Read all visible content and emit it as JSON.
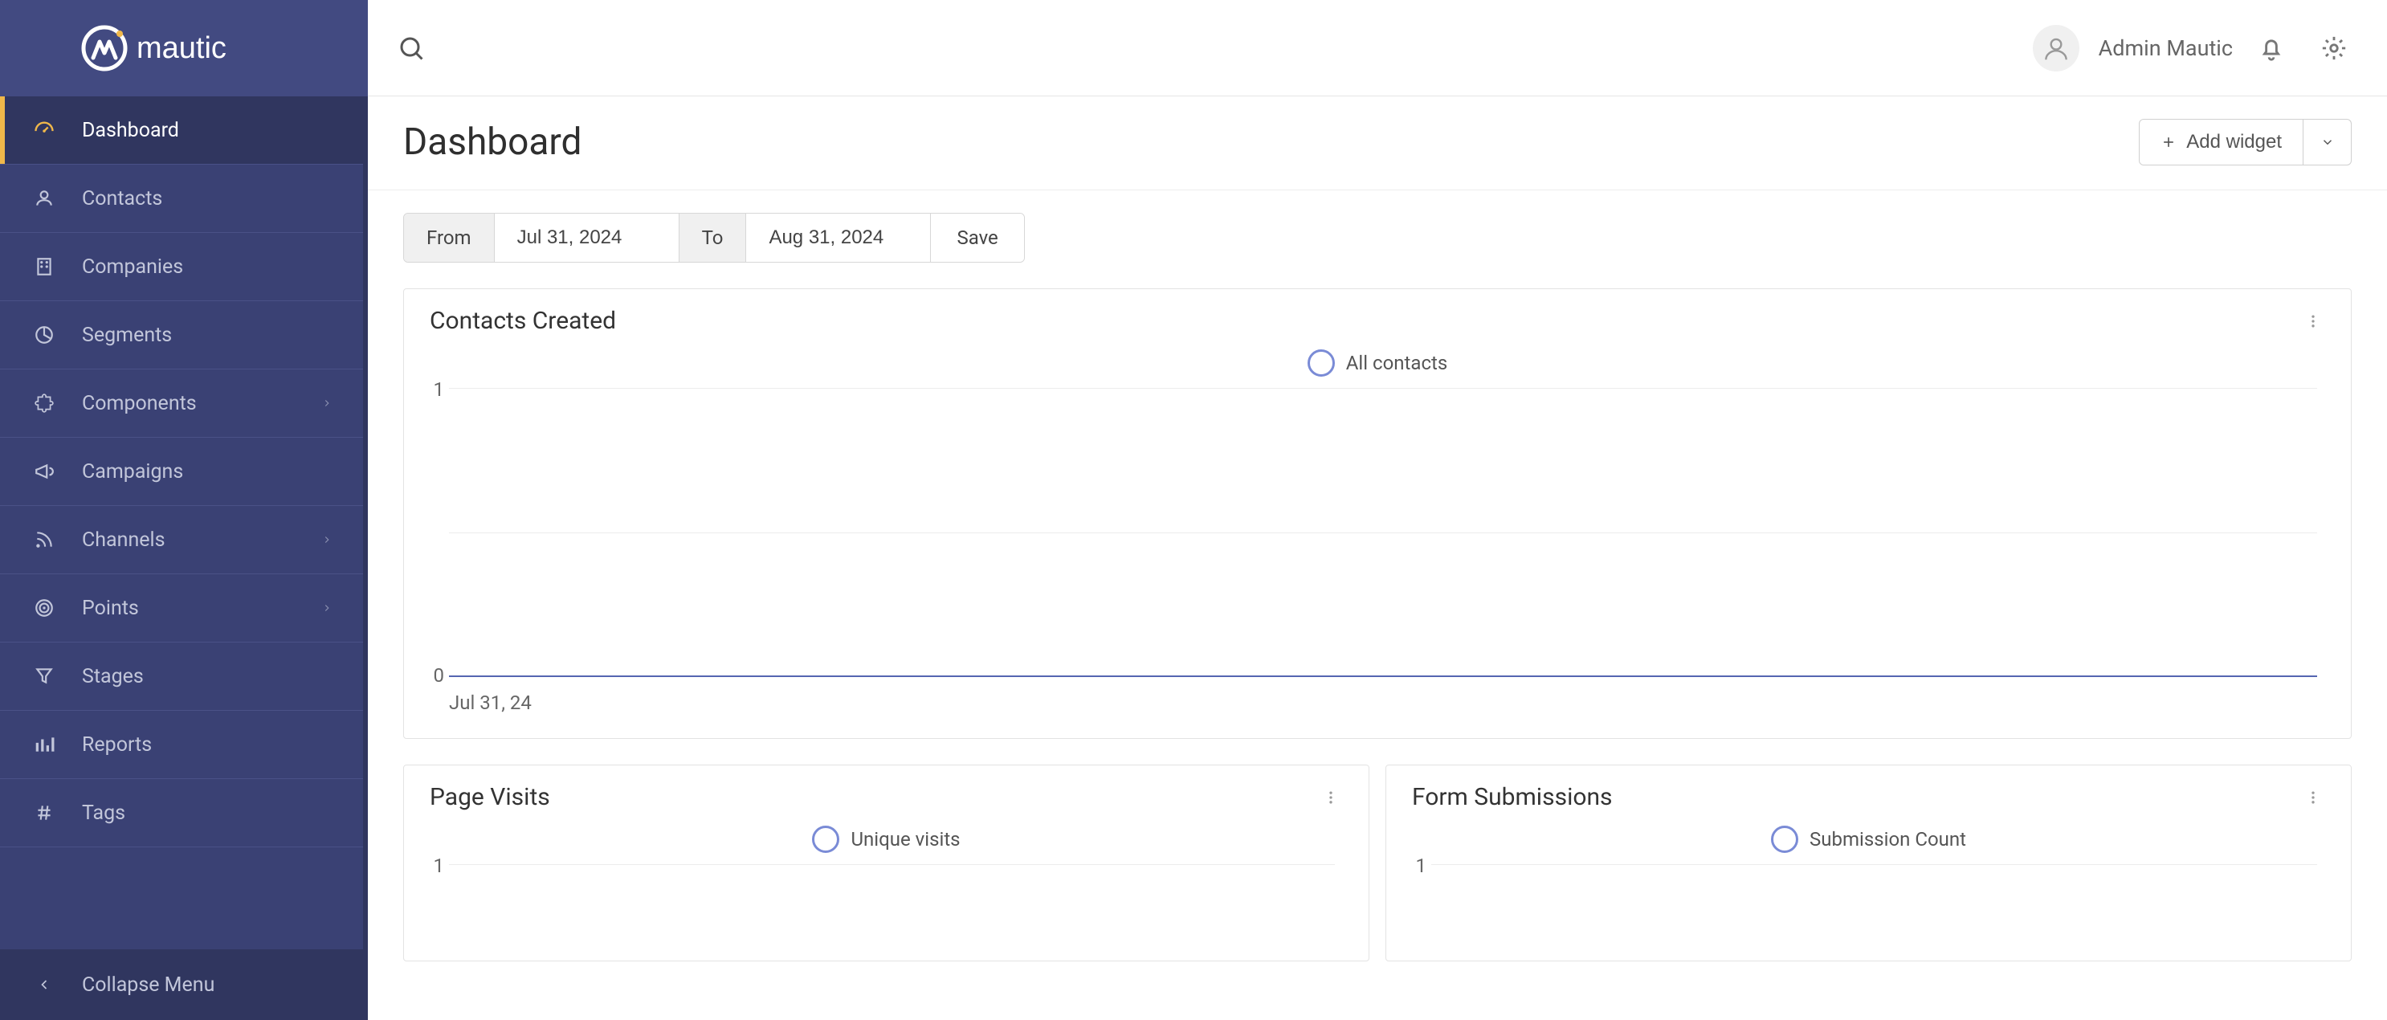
{
  "brand": {
    "name": "mautic"
  },
  "user": {
    "name": "Admin Mautic"
  },
  "page": {
    "title": "Dashboard"
  },
  "header_actions": {
    "add_widget_label": "Add widget"
  },
  "date_filter": {
    "from_label": "From",
    "to_label": "To",
    "from_value": "Jul 31, 2024",
    "to_value": "Aug 31, 2024",
    "save_label": "Save"
  },
  "sidebar": {
    "items": [
      {
        "label": "Dashboard",
        "icon": "gauge-icon",
        "expandable": false,
        "active": true
      },
      {
        "label": "Contacts",
        "icon": "user-icon",
        "expandable": false,
        "active": false
      },
      {
        "label": "Companies",
        "icon": "building-icon",
        "expandable": false,
        "active": false
      },
      {
        "label": "Segments",
        "icon": "pie-icon",
        "expandable": false,
        "active": false
      },
      {
        "label": "Components",
        "icon": "puzzle-icon",
        "expandable": true,
        "active": false
      },
      {
        "label": "Campaigns",
        "icon": "megaphone-icon",
        "expandable": false,
        "active": false
      },
      {
        "label": "Channels",
        "icon": "rss-icon",
        "expandable": true,
        "active": false
      },
      {
        "label": "Points",
        "icon": "target-icon",
        "expandable": true,
        "active": false
      },
      {
        "label": "Stages",
        "icon": "funnel-icon",
        "expandable": false,
        "active": false
      },
      {
        "label": "Reports",
        "icon": "barline-icon",
        "expandable": false,
        "active": false
      },
      {
        "label": "Tags",
        "icon": "hash-icon",
        "expandable": false,
        "active": false
      }
    ],
    "collapse_label": "Collapse Menu"
  },
  "widgets": {
    "contacts_created": {
      "title": "Contacts Created",
      "legend": "All contacts",
      "y_top_label": "1",
      "y_bottom_label": "0",
      "x_label": "Jul 31, 24"
    },
    "page_visits": {
      "title": "Page Visits",
      "legend": "Unique visits",
      "y_top_label": "1"
    },
    "form_submissions": {
      "title": "Form Submissions",
      "legend": "Submission Count",
      "y_top_label": "1"
    }
  },
  "chart_data": [
    {
      "widget": "Contacts Created",
      "type": "line",
      "series": [
        {
          "name": "All contacts",
          "values": [
            0
          ]
        }
      ],
      "categories": [
        "Jul 31, 24"
      ],
      "ylim": [
        0,
        1
      ],
      "xlabel": "",
      "ylabel": ""
    },
    {
      "widget": "Page Visits",
      "type": "line",
      "series": [
        {
          "name": "Unique visits",
          "values": []
        }
      ],
      "categories": [],
      "ylim": [
        0,
        1
      ],
      "xlabel": "",
      "ylabel": ""
    },
    {
      "widget": "Form Submissions",
      "type": "line",
      "series": [
        {
          "name": "Submission Count",
          "values": []
        }
      ],
      "categories": [],
      "ylim": [
        0,
        1
      ],
      "xlabel": "",
      "ylabel": ""
    }
  ],
  "colors": {
    "sidebar_bg": "#3a4174",
    "sidebar_active": "#30365f",
    "accent": "#f0b84a",
    "chart_line": "#5565b1"
  }
}
